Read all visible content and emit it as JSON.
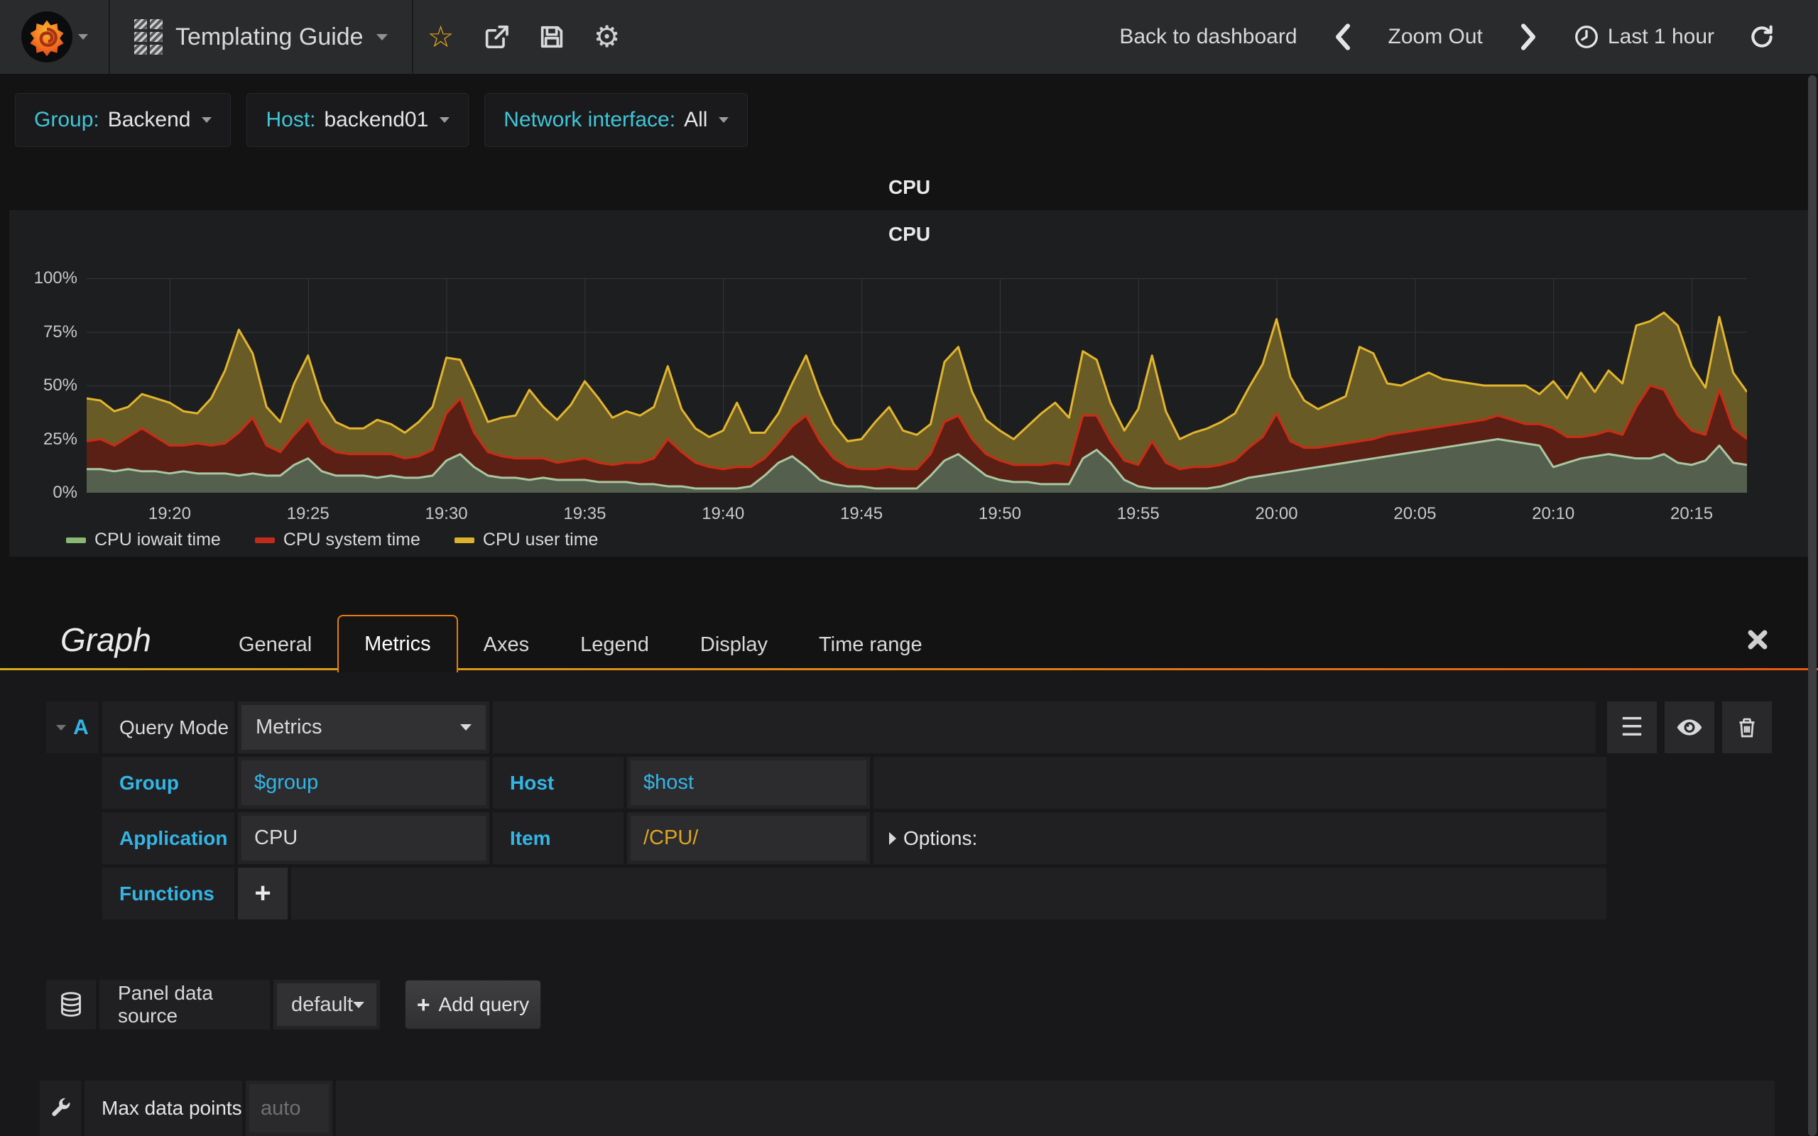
{
  "navbar": {
    "title": "Templating Guide",
    "back_to_dashboard": "Back to dashboard",
    "zoom_out": "Zoom Out",
    "time_range": "Last 1 hour"
  },
  "variables": [
    {
      "label": "Group:",
      "value": "Backend"
    },
    {
      "label": "Host:",
      "value": "backend01"
    },
    {
      "label": "Network interface:",
      "value": "All"
    }
  ],
  "panel": {
    "title": "CPU"
  },
  "chart_data": {
    "type": "area",
    "stacked": true,
    "title": "CPU",
    "xlabel": "",
    "ylabel": "",
    "ylim": [
      0,
      100
    ],
    "grid": true,
    "legend_position": "bottom",
    "x_start": "19:17",
    "x_end": "20:17",
    "step_seconds": 30,
    "x_ticks": [
      "19:20",
      "19:25",
      "19:30",
      "19:35",
      "19:40",
      "19:45",
      "19:50",
      "19:55",
      "20:00",
      "20:05",
      "20:10",
      "20:15"
    ],
    "x_tick_minutes": [
      3,
      8,
      13,
      18,
      23,
      28,
      33,
      38,
      43,
      48,
      53,
      58
    ],
    "y_ticks": [
      "0%",
      "25%",
      "50%",
      "75%",
      "100%"
    ],
    "y_tick_values": [
      0,
      25,
      50,
      75,
      100
    ],
    "series": [
      {
        "name": "CPU iowait time",
        "legend_color": "#8ab873",
        "line_color": "#a9c7a0",
        "fill_color": "#545f4e",
        "values": [
          11,
          11,
          10,
          11,
          10,
          10,
          9,
          10,
          9,
          9,
          9,
          8,
          9,
          8,
          8,
          13,
          16,
          10,
          8,
          8,
          8,
          7,
          8,
          7,
          7,
          8,
          15,
          18,
          12,
          8,
          7,
          7,
          6,
          7,
          6,
          6,
          6,
          5,
          5,
          5,
          4,
          4,
          3,
          3,
          2,
          2,
          2,
          2,
          3,
          8,
          14,
          17,
          12,
          6,
          4,
          3,
          3,
          2,
          2,
          2,
          2,
          8,
          15,
          18,
          13,
          8,
          6,
          5,
          5,
          4,
          4,
          4,
          16,
          20,
          14,
          6,
          3,
          2,
          2,
          2,
          2,
          2,
          3,
          5,
          7,
          8,
          9,
          10,
          11,
          12,
          13,
          14,
          15,
          16,
          17,
          18,
          19,
          20,
          21,
          22,
          23,
          24,
          25,
          24,
          23,
          22,
          12,
          14,
          16,
          17,
          18,
          17,
          16,
          16,
          18,
          14,
          13,
          15,
          22,
          14,
          13
        ]
      },
      {
        "name": "CPU system time",
        "legend_color": "#c02c1a",
        "line_color": "#cc2b15",
        "fill_color": "#5a2015",
        "values": [
          13,
          14,
          12,
          15,
          20,
          16,
          13,
          12,
          14,
          13,
          14,
          20,
          26,
          14,
          11,
          14,
          18,
          13,
          11,
          10,
          10,
          11,
          10,
          9,
          10,
          12,
          22,
          26,
          16,
          11,
          10,
          9,
          10,
          9,
          8,
          9,
          10,
          9,
          8,
          9,
          10,
          12,
          22,
          16,
          12,
          10,
          9,
          10,
          9,
          8,
          9,
          14,
          24,
          18,
          12,
          9,
          8,
          9,
          10,
          9,
          9,
          10,
          18,
          18,
          12,
          10,
          9,
          8,
          8,
          9,
          10,
          9,
          20,
          16,
          10,
          9,
          10,
          22,
          12,
          9,
          10,
          10,
          10,
          10,
          14,
          18,
          28,
          14,
          10,
          9,
          9,
          9,
          9,
          9,
          10,
          10,
          10,
          10,
          10,
          10,
          10,
          10,
          11,
          10,
          9,
          10,
          18,
          12,
          10,
          10,
          11,
          10,
          24,
          34,
          30,
          22,
          16,
          12,
          26,
          16,
          12
        ]
      },
      {
        "name": "CPU user time",
        "legend_color": "#dcb22c",
        "line_color": "#e2b52e",
        "fill_color": "#695b25",
        "values": [
          20,
          18,
          16,
          14,
          16,
          18,
          20,
          16,
          14,
          22,
          34,
          48,
          30,
          18,
          14,
          24,
          30,
          20,
          14,
          12,
          12,
          16,
          14,
          12,
          16,
          20,
          26,
          18,
          20,
          14,
          18,
          20,
          32,
          24,
          20,
          26,
          36,
          30,
          22,
          24,
          22,
          24,
          34,
          20,
          16,
          14,
          18,
          30,
          16,
          12,
          14,
          20,
          28,
          22,
          16,
          12,
          14,
          22,
          28,
          18,
          16,
          14,
          28,
          32,
          22,
          16,
          14,
          12,
          18,
          24,
          28,
          22,
          30,
          26,
          18,
          14,
          26,
          40,
          24,
          14,
          16,
          18,
          20,
          22,
          28,
          34,
          44,
          30,
          22,
          18,
          20,
          22,
          44,
          40,
          24,
          22,
          24,
          26,
          22,
          20,
          18,
          16,
          14,
          16,
          18,
          14,
          22,
          18,
          30,
          20,
          28,
          24,
          38,
          30,
          36,
          42,
          30,
          22,
          34,
          26,
          22
        ]
      }
    ]
  },
  "editor": {
    "panel_type": "Graph",
    "tabs": [
      {
        "label": "General"
      },
      {
        "label": "Metrics"
      },
      {
        "label": "Axes"
      },
      {
        "label": "Legend"
      },
      {
        "label": "Display"
      },
      {
        "label": "Time range"
      }
    ]
  },
  "query": {
    "ref_id": "A",
    "query_mode_label": "Query Mode",
    "query_mode_value": "Metrics",
    "group_label": "Group",
    "group_value": "$group",
    "host_label": "Host",
    "host_value": "$host",
    "application_label": "Application",
    "application_value": "CPU",
    "item_label": "Item",
    "item_value": "/CPU/",
    "options_label": "Options:",
    "functions_label": "Functions",
    "add_function_label": "+"
  },
  "datasource": {
    "label": "Panel data source",
    "value": "default",
    "add_query_label": "Add query"
  },
  "settings": {
    "max_data_points_label": "Max data points",
    "max_data_points_placeholder": "auto"
  }
}
